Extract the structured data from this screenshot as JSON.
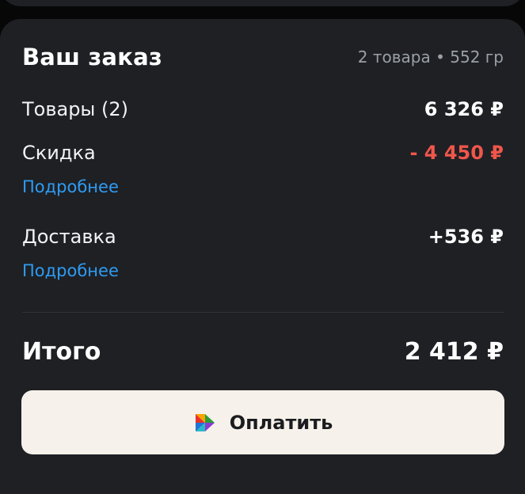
{
  "order": {
    "title": "Ваш заказ",
    "summary": "2 товара • 552 гр",
    "goods": {
      "label": "Товары (2)",
      "value": "6 326 ₽"
    },
    "discount": {
      "label": "Скидка",
      "value": "- 4 450 ₽",
      "more": "Подробнее"
    },
    "delivery": {
      "label": "Доставка",
      "value": "+536 ₽",
      "more": "Подробнее"
    },
    "total": {
      "label": "Итого",
      "value": "2 412 ₽"
    }
  },
  "pay_button": {
    "label": "Оплатить",
    "icon": "sberpay-logo-icon"
  },
  "colors": {
    "card_bg": "#1e2024",
    "discount": "#f0564b",
    "link": "#2f9bf2",
    "button_bg": "#f6f1ea"
  }
}
